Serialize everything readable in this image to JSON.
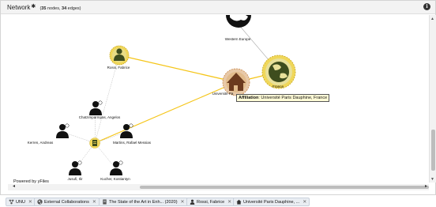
{
  "panel": {
    "title": "Network",
    "title_icon": "gear-icon",
    "stats_nodes": "35",
    "stats_nodes_word": "nodes",
    "stats_edges": "34",
    "stats_edges_word": "edges",
    "info_icon": "info-icon",
    "info_label": "i"
  },
  "graph": {
    "nodes": {
      "western_europe": "Western Europe",
      "rossi": "Rossi, Fabrice",
      "france": "France",
      "universite": "Université Pa",
      "chatzimparmpas": "Chatzimparmpas, Angelos",
      "kerren": "Kerren, Andreas",
      "martins": "Martins, Rafael Messias",
      "jusufi": "Jusufi, Ilir",
      "kucher": "Kucher, Kostiantyn"
    },
    "tooltip_key": "Affiliation",
    "tooltip_value": ": Université Paris Dauphine, France",
    "powered_by": "Powered by yFiles",
    "colors": {
      "highlight_edge": "#f5c518",
      "node_gold": "#f0d75a",
      "node_green": "#3e4d1e",
      "node_brown": "#6b3a1e"
    }
  },
  "tabs": [
    {
      "label": "UNU",
      "icon": "network-icon"
    },
    {
      "label": "External Collaborations",
      "icon": "globe-icon"
    },
    {
      "label": "The State of the Art in Enh... (2020)",
      "icon": "document-icon"
    },
    {
      "label": "Rossi, Fabrice",
      "icon": "person-icon"
    },
    {
      "label": "Université Paris Dauphine, ...",
      "icon": "home-icon"
    }
  ],
  "close_glyph": "✕"
}
